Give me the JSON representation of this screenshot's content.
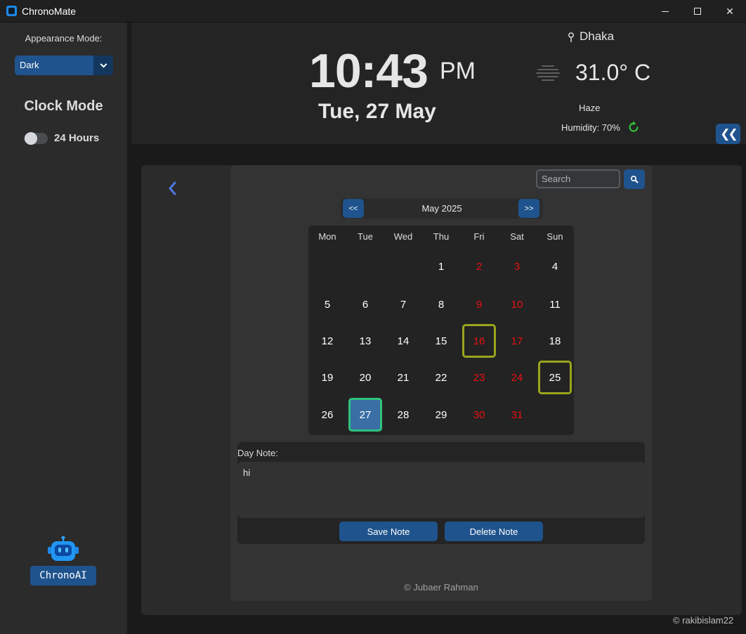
{
  "window": {
    "title": "ChronoMate",
    "minimize": "—",
    "maximize": "☐",
    "close": "✕"
  },
  "sidebar": {
    "appearance_label": "Appearance Mode:",
    "appearance_value": "Dark",
    "clock_mode_title": "Clock Mode",
    "clock_toggle_label": "24 Hours",
    "clock_toggle_on": false,
    "ai_button_label": "ChronoAI"
  },
  "header": {
    "time": "10:43",
    "ampm": "PM",
    "date": "Tue, 27 May",
    "city": "Dhaka",
    "temperature": "31.0° C",
    "condition": "Haze",
    "humidity": "Humidity: 70%",
    "collapse_label": "❮❮"
  },
  "calendar": {
    "search_placeholder": "Search",
    "prev_label": "<<",
    "next_label": ">>",
    "month_label": "May 2025",
    "weekdays": [
      "Mon",
      "Tue",
      "Wed",
      "Thu",
      "Fri",
      "Sat",
      "Sun"
    ],
    "first_weekday_index": 3,
    "days_in_month": 31,
    "holiday_days": [
      2,
      3,
      9,
      10,
      16,
      17,
      23,
      24,
      30,
      31
    ],
    "marked_days": [
      16,
      25
    ],
    "today": 27,
    "note_label": "Day Note:",
    "note_text": "hi",
    "save_label": "Save Note",
    "delete_label": "Delete Note",
    "footer_credit": "© Jubaer Rahman"
  },
  "corner_credit": "© rakibislam22",
  "colors": {
    "accent": "#1f538d",
    "holiday": "#e81010",
    "marked_border": "#9aa51c",
    "today_border": "#2ec27e",
    "today_fill": "#3a6fa5"
  }
}
